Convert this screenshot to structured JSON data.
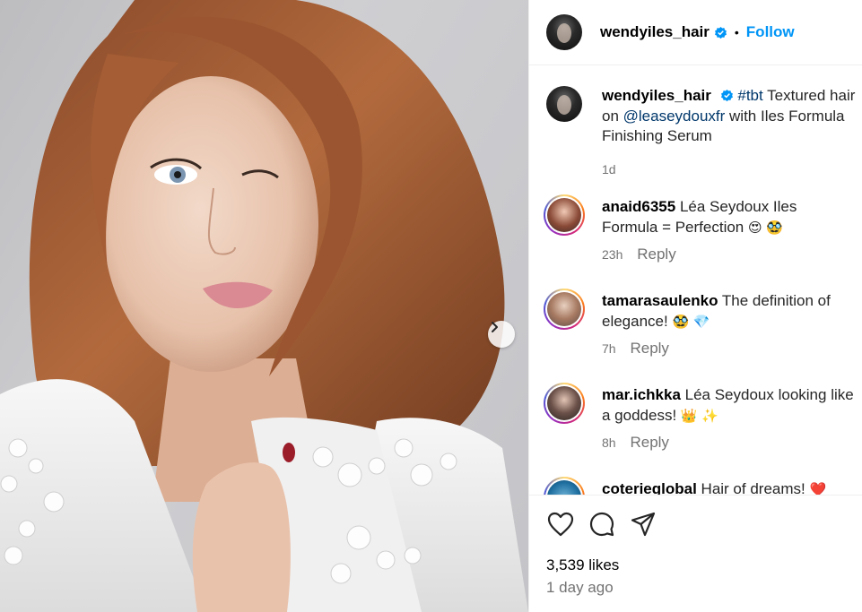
{
  "post": {
    "author": "wendyiles_hair",
    "follow_label": "Follow",
    "separator": "•",
    "caption_hashtag": "#tbt",
    "caption_text_1": " Textured hair on ",
    "caption_mention": "@leaseydouxfr",
    "caption_text_2": " with Iles Formula Finishing Serum",
    "caption_time": "1d"
  },
  "comments": [
    {
      "user": "anaid6355",
      "text": " Léa Seydoux Iles Formula = Perfection ",
      "emojis": "😍 🥸",
      "time": "23h",
      "reply": "Reply"
    },
    {
      "user": "tamarasaulenko",
      "text": " The definition of elegance! ",
      "emojis": "🥸 💎",
      "time": "7h",
      "reply": "Reply"
    },
    {
      "user": "mar.ichkka",
      "text": " Léa Seydoux looking like a goddess! ",
      "emojis": "👑 ✨",
      "time": "8h",
      "reply": "Reply"
    },
    {
      "user": "coterieglobal",
      "text": " Hair of dreams! ",
      "emojis": "❤️",
      "time": "",
      "reply": ""
    }
  ],
  "footer": {
    "likes": "3,539 likes",
    "time_ago": "1 day ago"
  },
  "icons": {
    "like": "heart-icon",
    "comment": "comment-icon",
    "share": "send-icon",
    "next": "chevron-right-icon",
    "verified": "verified-badge-icon"
  },
  "colors": {
    "accent": "#0095f6",
    "verified": "#0095f6",
    "meta": "#737373",
    "link": "#00376b"
  }
}
